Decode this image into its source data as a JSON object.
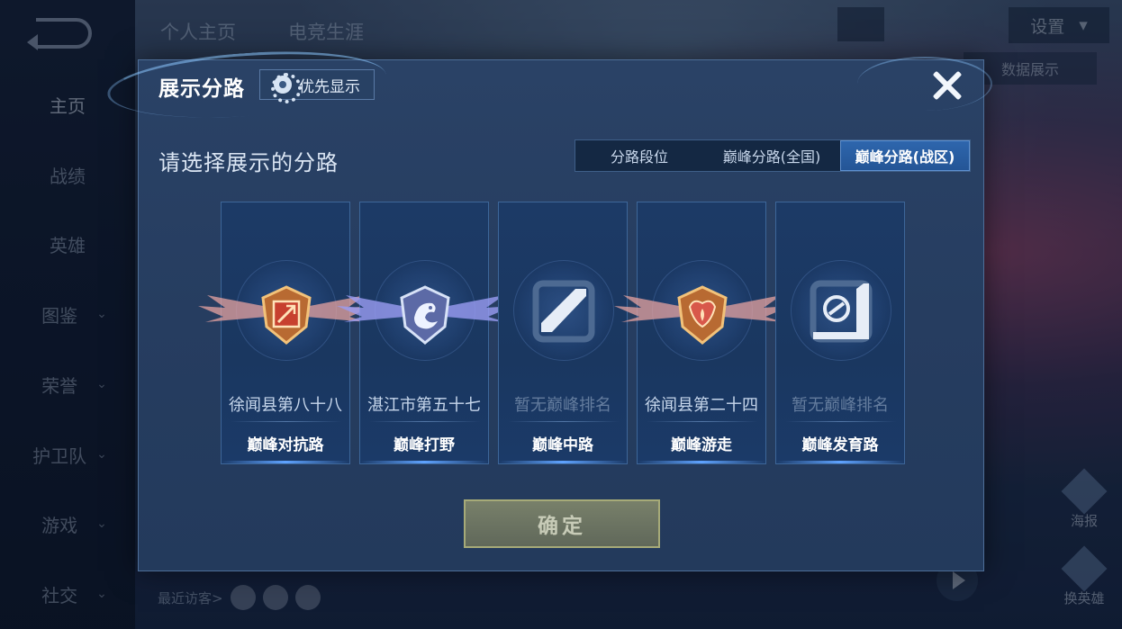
{
  "background": {
    "top_tabs": [
      "个人主页",
      "电竞生涯"
    ],
    "settings_label": "设置",
    "right_panel_button": "数据展示",
    "right_icons": [
      {
        "label": "海报"
      },
      {
        "label": "换英雄"
      }
    ],
    "visitors_label": "最近访客>"
  },
  "sidebar": {
    "items": [
      {
        "label": "主页",
        "active": true,
        "has_chevron": false
      },
      {
        "label": "战绩",
        "active": false,
        "has_chevron": false
      },
      {
        "label": "英雄",
        "active": false,
        "has_chevron": false
      },
      {
        "label": "图鉴",
        "active": false,
        "has_chevron": true
      },
      {
        "label": "荣誉",
        "active": false,
        "has_chevron": true
      },
      {
        "label": "护卫队",
        "active": false,
        "has_chevron": true
      },
      {
        "label": "游戏",
        "active": false,
        "has_chevron": true
      },
      {
        "label": "社交",
        "active": false,
        "has_chevron": true
      }
    ]
  },
  "modal": {
    "title": "展示分路",
    "priority_label": "优先显示",
    "prompt": "请选择展示的分路",
    "segments": [
      {
        "label": "分路段位",
        "selected": false
      },
      {
        "label": "巅峰分路(全国)",
        "selected": false
      },
      {
        "label": "巅峰分路(战区)",
        "selected": true
      }
    ],
    "cards": [
      {
        "rank": "徐闻县第八十八",
        "lane": "巅峰对抗路",
        "has_rank": true,
        "icon": "clash-lane-badge-icon"
      },
      {
        "rank": "湛江市第五十七",
        "lane": "巅峰打野",
        "has_rank": true,
        "icon": "jungle-badge-icon"
      },
      {
        "rank": "暂无巅峰排名",
        "lane": "巅峰中路",
        "has_rank": false,
        "icon": "mid-lane-icon"
      },
      {
        "rank": "徐闻县第二十四",
        "lane": "巅峰游走",
        "has_rank": true,
        "icon": "roam-badge-icon"
      },
      {
        "rank": "暂无巅峰排名",
        "lane": "巅峰发育路",
        "has_rank": false,
        "icon": "farm-lane-icon"
      }
    ],
    "confirm_label": "确定"
  },
  "colors": {
    "modal_bg": "#263d60",
    "segment_selected": "#2e66ad",
    "confirm_border": "#a6aa78",
    "gold_badge": "#d9924a",
    "silver_badge": "#8f9fce"
  }
}
